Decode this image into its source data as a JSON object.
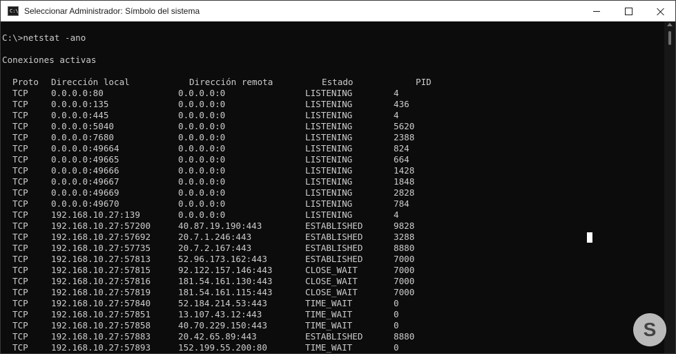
{
  "window": {
    "title": "Seleccionar Administrador: Símbolo del sistema",
    "icon_text": "C:\\",
    "controls": [
      "minimize",
      "maximize",
      "close"
    ]
  },
  "console": {
    "command_line": "C:\\>netstat -ano",
    "section_title": "Conexiones activas",
    "headers": {
      "proto": "Proto",
      "local": "Dirección local",
      "remote": "Dirección remota",
      "state": "Estado",
      "pid": "PID"
    },
    "rows": [
      [
        "TCP",
        "0.0.0.0:80",
        "0.0.0.0:0",
        "LISTENING",
        "4"
      ],
      [
        "TCP",
        "0.0.0.0:135",
        "0.0.0.0:0",
        "LISTENING",
        "436"
      ],
      [
        "TCP",
        "0.0.0.0:445",
        "0.0.0.0:0",
        "LISTENING",
        "4"
      ],
      [
        "TCP",
        "0.0.0.0:5040",
        "0.0.0.0:0",
        "LISTENING",
        "5620"
      ],
      [
        "TCP",
        "0.0.0.0:7680",
        "0.0.0.0:0",
        "LISTENING",
        "2388"
      ],
      [
        "TCP",
        "0.0.0.0:49664",
        "0.0.0.0:0",
        "LISTENING",
        "824"
      ],
      [
        "TCP",
        "0.0.0.0:49665",
        "0.0.0.0:0",
        "LISTENING",
        "664"
      ],
      [
        "TCP",
        "0.0.0.0:49666",
        "0.0.0.0:0",
        "LISTENING",
        "1428"
      ],
      [
        "TCP",
        "0.0.0.0:49667",
        "0.0.0.0:0",
        "LISTENING",
        "1848"
      ],
      [
        "TCP",
        "0.0.0.0:49669",
        "0.0.0.0:0",
        "LISTENING",
        "2828"
      ],
      [
        "TCP",
        "0.0.0.0:49670",
        "0.0.0.0:0",
        "LISTENING",
        "784"
      ],
      [
        "TCP",
        "192.168.10.27:139",
        "0.0.0.0:0",
        "LISTENING",
        "4"
      ],
      [
        "TCP",
        "192.168.10.27:57200",
        "40.87.19.190:443",
        "ESTABLISHED",
        "9828"
      ],
      [
        "TCP",
        "192.168.10.27:57692",
        "20.7.1.246:443",
        "ESTABLISHED",
        "3288"
      ],
      [
        "TCP",
        "192.168.10.27:57735",
        "20.7.2.167:443",
        "ESTABLISHED",
        "8880"
      ],
      [
        "TCP",
        "192.168.10.27:57813",
        "52.96.173.162:443",
        "ESTABLISHED",
        "7000"
      ],
      [
        "TCP",
        "192.168.10.27:57815",
        "92.122.157.146:443",
        "CLOSE_WAIT",
        "7000"
      ],
      [
        "TCP",
        "192.168.10.27:57816",
        "181.54.161.130:443",
        "CLOSE_WAIT",
        "7000"
      ],
      [
        "TCP",
        "192.168.10.27:57819",
        "181.54.161.115:443",
        "CLOSE_WAIT",
        "7000"
      ],
      [
        "TCP",
        "192.168.10.27:57840",
        "52.184.214.53:443",
        "TIME_WAIT",
        "0"
      ],
      [
        "TCP",
        "192.168.10.27:57851",
        "13.107.43.12:443",
        "TIME_WAIT",
        "0"
      ],
      [
        "TCP",
        "192.168.10.27:57858",
        "40.70.229.150:443",
        "TIME_WAIT",
        "0"
      ],
      [
        "TCP",
        "192.168.10.27:57883",
        "20.42.65.89:443",
        "ESTABLISHED",
        "8880"
      ],
      [
        "TCP",
        "192.168.10.27:57893",
        "152.199.55.200:80",
        "TIME_WAIT",
        "0"
      ]
    ]
  },
  "watermark": {
    "text": "S"
  },
  "colors": {
    "console_bg": "#0c0c0c",
    "console_text": "#cccccc",
    "titlebar_bg": "#ffffff"
  }
}
